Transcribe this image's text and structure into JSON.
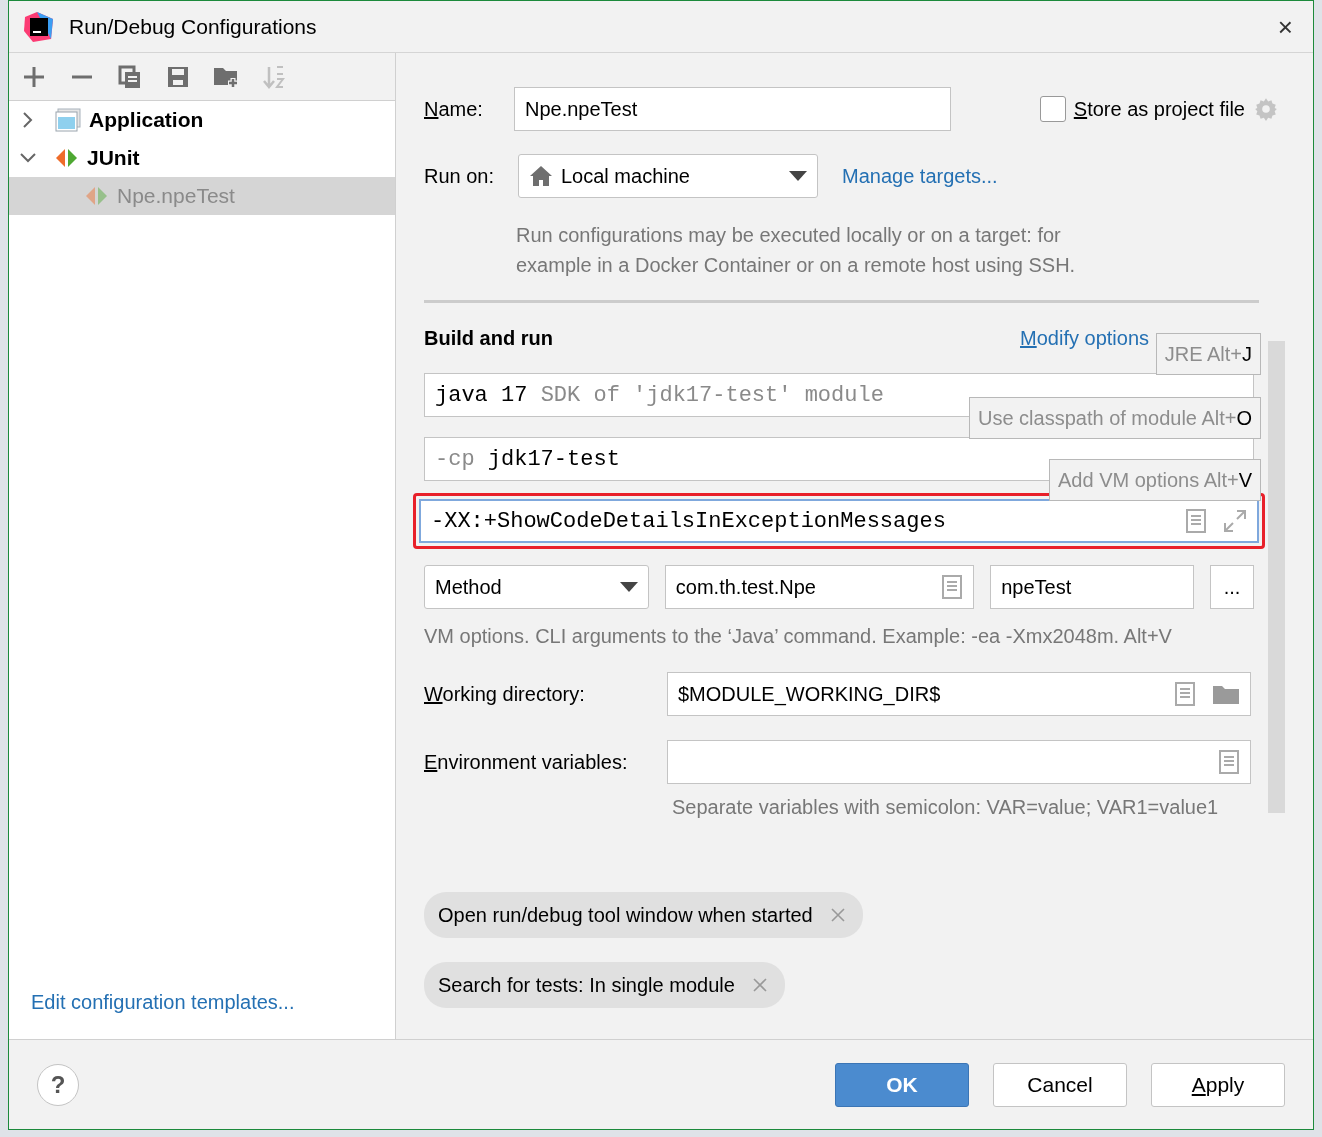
{
  "window": {
    "title": "Run/Debug Configurations",
    "close": "×"
  },
  "toolbar": [
    {
      "kind": "add",
      "disabled": false
    },
    {
      "kind": "remove",
      "disabled": false
    },
    {
      "kind": "copy",
      "disabled": false
    },
    {
      "kind": "save",
      "disabled": false
    },
    {
      "kind": "folder",
      "disabled": false
    },
    {
      "kind": "sort",
      "disabled": true
    }
  ],
  "tree": [
    {
      "label": "Application",
      "kind": "application",
      "expanded": false,
      "selected": false
    },
    {
      "label": "JUnit",
      "kind": "junit",
      "expanded": true,
      "selected": false,
      "children": [
        {
          "label": "Npe.npeTest",
          "kind": "junit",
          "selected": true
        }
      ]
    }
  ],
  "templates_link": "Edit configuration templates...",
  "form": {
    "name_label": "Name:",
    "name_value": "Npe.npeTest",
    "store": {
      "label": "Store as project file",
      "checked": false
    },
    "run_on_label": "Run on:",
    "run_on_value": "Local machine",
    "manage_link": "Manage targets...",
    "run_on_help": "Run configurations may be executed locally or on a target: for example in a Docker Container or on a remote host using SSH.",
    "section_title": "Build and run",
    "modify_link": "Modify options",
    "jre": {
      "value": "java 17",
      "hint": "SDK of 'jdk17-test' module"
    },
    "classpath": {
      "prefix": "-cp",
      "value": "jdk17-test"
    },
    "vm_options": {
      "value": "-XX:+ShowCodeDetailsInExceptionMessages",
      "highlighted": true
    },
    "test_kind": "Method",
    "test_class": "com.th.test.Npe",
    "test_method": "npeTest",
    "more_button": "...",
    "vm_help": "VM options. CLI arguments to the ‘Java’ command. Example: -ea -Xmx2048m. Alt+V",
    "working_dir_label": "Working directory:",
    "working_dir_value": "$MODULE_WORKING_DIR$",
    "env_label": "Environment variables:",
    "env_help": "Separate variables with semicolon: VAR=value; VAR1=value1",
    "chips": [
      "Open run/debug tool window when started",
      "Search for tests: In single module"
    ]
  },
  "hints": [
    {
      "label": "JRE Alt+",
      "key": "J"
    },
    {
      "label": "Use classpath of module Alt+",
      "key": "O"
    },
    {
      "label": "Add VM options Alt+",
      "key": "V"
    }
  ],
  "help_button": "?",
  "buttons": [
    {
      "label": "OK",
      "kind": "primary"
    },
    {
      "label": "Cancel",
      "kind": "secondary"
    },
    {
      "label": "Apply",
      "kind": "secondary",
      "mnemonic": true
    }
  ]
}
